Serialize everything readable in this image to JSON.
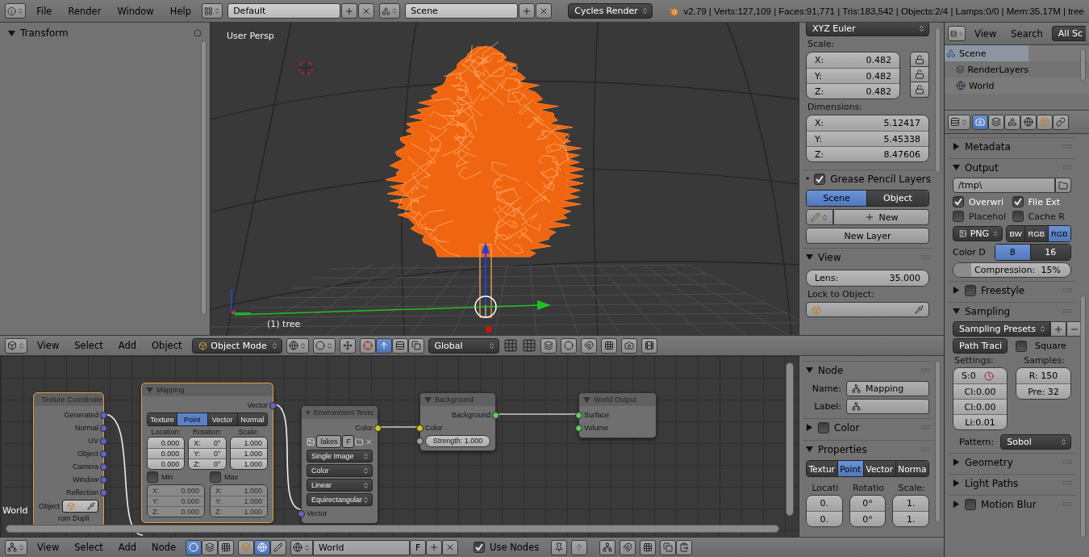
{
  "top_bar": {
    "menus": [
      "File",
      "Render",
      "Window",
      "Help"
    ],
    "screen_layout": "Default",
    "scene": "Scene",
    "render_engine": "Cycles Render",
    "stats": "v2.79 | Verts:127,109 | Faces:91,771 | Tris:183,542 | Objects:2/4 | Lamps:0/0 | Mem:35.17M | tree"
  },
  "tool_shelf": {
    "panel": {
      "title": "Transform",
      "expanded": true
    }
  },
  "viewport": {
    "view_name": "User Persp",
    "object_name": "(1) tree"
  },
  "view_sidebar": {
    "rotation_mode": "XYZ Euler",
    "scale": {
      "label": "Scale:",
      "fields": [
        {
          "axis": "X:",
          "value": "0.482",
          "locked": false
        },
        {
          "axis": "Y:",
          "value": "0.482",
          "locked": false
        },
        {
          "axis": "Z:",
          "value": "0.482",
          "locked": false
        }
      ]
    },
    "dimensions": {
      "label": "Dimensions:",
      "fields": [
        {
          "axis": "X:",
          "value": "5.12417"
        },
        {
          "axis": "Y:",
          "value": "5.45338"
        },
        {
          "axis": "Z:",
          "value": "8.47606"
        }
      ]
    },
    "grease_pencil": {
      "title": "Grease Pencil Layers",
      "expanded": true,
      "enabled": true,
      "tabs": [
        {
          "label": "Scene",
          "selected": true
        },
        {
          "label": "Object",
          "selected": false
        }
      ],
      "new_button": "New",
      "new_layer_button": "New Layer"
    },
    "view_panel": {
      "title": "View",
      "expanded": true,
      "lens_label": "Lens:",
      "lens": "35.000",
      "lock_label": "Lock to Object:"
    }
  },
  "view_header": {
    "menus": [
      "View",
      "Select",
      "Add",
      "Object"
    ],
    "mode": "Object Mode",
    "orientation": "Global"
  },
  "node_editor": {
    "tree_name": "World",
    "nodes": [
      {
        "kind": "texcoord",
        "title": "Texture Coordinate",
        "selected": true,
        "outputs": [
          "Generated",
          "Normal",
          "UV",
          "Object",
          "Camera",
          "Window",
          "Reflection"
        ],
        "object_label": "Object",
        "dupli_label": "rom Dupli"
      },
      {
        "kind": "mapping",
        "title": "Mapping",
        "selected": true,
        "output": "Vector",
        "tabs": [
          {
            "label": "Texture",
            "selected": false
          },
          {
            "label": "Point",
            "selected": true
          },
          {
            "label": "Vector",
            "selected": false
          },
          {
            "label": "Normal",
            "selected": false
          }
        ],
        "columns": [
          {
            "label": "Location:",
            "fields": [
              {
                "value": "0.000"
              },
              {
                "value": "0.000"
              },
              {
                "value": "0.000"
              }
            ]
          },
          {
            "label": "Rotation:",
            "fields": [
              {
                "axis": "X:",
                "value": "0°"
              },
              {
                "axis": "Y:",
                "value": "0°"
              },
              {
                "axis": "Z:",
                "value": "0°"
              }
            ]
          },
          {
            "label": "Scale:",
            "fields": [
              {
                "value": "1.000"
              },
              {
                "value": "1.000"
              },
              {
                "value": "1.000"
              }
            ]
          }
        ],
        "limits": [
          {
            "label": "Min",
            "checked": false,
            "fields": [
              {
                "axis": "X:",
                "value": "0.000"
              },
              {
                "axis": "Y:",
                "value": "0.000"
              },
              {
                "axis": "Z:",
                "value": "0.000"
              }
            ]
          },
          {
            "label": "Max",
            "checked": false,
            "fields": [
              {
                "axis": "X:",
                "value": "1.000"
              },
              {
                "axis": "Y:",
                "value": "1.000"
              },
              {
                "axis": "Z:",
                "value": "1.000"
              }
            ]
          }
        ]
      },
      {
        "kind": "envtex",
        "title": "Environment Textu",
        "selected": false,
        "output": "Color",
        "image": "lakes",
        "fake_user": "F",
        "options": [
          "Single Image",
          "Color",
          "Linear",
          "Equirectangular"
        ],
        "input": "Vector"
      },
      {
        "kind": "background",
        "title": "Background",
        "selected": false,
        "output": "Background",
        "input": "Color",
        "strength": "Strength: 1.000"
      },
      {
        "kind": "output",
        "title": "World Output",
        "selected": false,
        "inputs": [
          "Surface",
          "Volume"
        ]
      }
    ]
  },
  "node_sidebar": {
    "node_panel": {
      "title": "Node",
      "expanded": true,
      "name_label": "Name:",
      "name": "Mapping",
      "label_label": "Label:"
    },
    "color_panel": {
      "title": "Color",
      "expanded": false,
      "enabled": false
    },
    "properties_panel": {
      "title": "Properties",
      "expanded": true,
      "tabs": [
        {
          "label": "Textur",
          "selected": false
        },
        {
          "label": "Point",
          "selected": true
        },
        {
          "label": "Vector",
          "selected": false
        },
        {
          "label": "Norma",
          "selected": false
        }
      ],
      "columns": [
        {
          "label": "Locati",
          "values": [
            "0.",
            "0."
          ]
        },
        {
          "label": "Rotatio",
          "values": [
            "0°",
            "0°"
          ]
        },
        {
          "label": "Scale:",
          "values": [
            "1.",
            "1."
          ]
        }
      ]
    }
  },
  "node_header": {
    "menus": [
      "View",
      "Select",
      "Add",
      "Node"
    ],
    "world": "World",
    "fake_user": "F",
    "use_nodes": {
      "label": "Use Nodes",
      "checked": true
    }
  },
  "outliner": {
    "menus": [
      "View",
      "Search"
    ],
    "filter": "All Sc",
    "items": [
      {
        "label": "Scene",
        "selected": true,
        "children": [
          {
            "label": "RenderLayers",
            "selected": false
          },
          {
            "label": "World",
            "selected": false
          }
        ]
      }
    ]
  },
  "properties": {
    "panels": [
      {
        "kind": "plain",
        "title": "Metadata",
        "expanded": false
      },
      {
        "kind": "output",
        "title": "Output",
        "expanded": true,
        "path": "/tmp\\",
        "checks": [
          {
            "label": "Overwri",
            "checked": true
          },
          {
            "label": "File Ext",
            "checked": true
          },
          {
            "label": "Placehol",
            "checked": false
          },
          {
            "label": "Cache R",
            "checked": false
          }
        ],
        "format": "PNG",
        "color_modes": [
          {
            "label": "BW",
            "selected": false
          },
          {
            "label": "RGB",
            "selected": false
          },
          {
            "label": "RGB",
            "selected": true
          }
        ],
        "depth_label": "Color D",
        "depths": [
          {
            "label": "8",
            "selected": true
          },
          {
            "label": "16",
            "selected": false
          }
        ],
        "compression": {
          "label": "Compression:",
          "value": "15%",
          "level": 0.15
        }
      },
      {
        "kind": "toggle",
        "title": "Freestyle",
        "expanded": false,
        "enabled": false
      },
      {
        "kind": "sampling",
        "title": "Sampling",
        "expanded": true,
        "presets": "Sampling Presets",
        "integrator": "Path Traci",
        "square": {
          "label": "Square",
          "checked": false
        },
        "settings_label": "Settings:",
        "settings": [
          "S:0",
          "Cl:0.00",
          "Cl:0.00",
          "Li:0.01"
        ],
        "samples_label": "Samples:",
        "samples": [
          "R: 150",
          "Pre: 32"
        ],
        "pattern_label": "Pattern:",
        "pattern": "Sobol"
      },
      {
        "kind": "plain",
        "title": "Geometry",
        "expanded": false
      },
      {
        "kind": "plain",
        "title": "Light Paths",
        "expanded": false
      },
      {
        "kind": "toggle",
        "title": "Motion Blur",
        "expanded": false,
        "enabled": false
      }
    ]
  }
}
